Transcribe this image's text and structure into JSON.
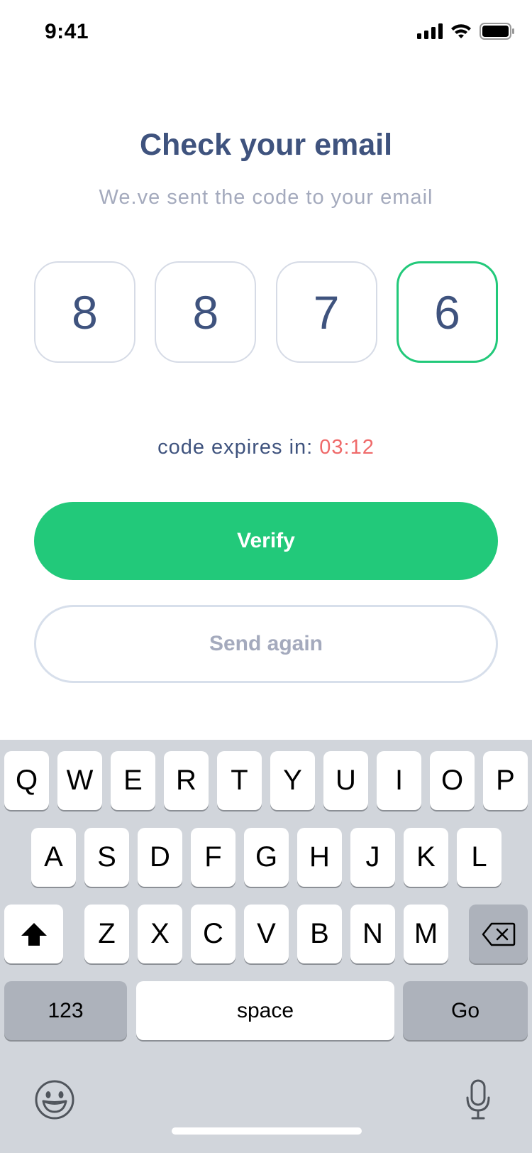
{
  "status_bar": {
    "time": "9:41",
    "icons": [
      "signal-icon",
      "wifi-icon",
      "battery-icon"
    ]
  },
  "header": {
    "title": "Check your email",
    "subtitle": "We.ve sent the code to your email"
  },
  "code": {
    "digits": [
      "8",
      "8",
      "7",
      "6"
    ],
    "active_index": 3
  },
  "timer": {
    "label": "code expires in:",
    "value": "03:12"
  },
  "buttons": {
    "verify": "Verify",
    "send_again": "Send again"
  },
  "keyboard": {
    "row1": [
      "Q",
      "W",
      "E",
      "R",
      "T",
      "Y",
      "U",
      "I",
      "O",
      "P"
    ],
    "row2": [
      "A",
      "S",
      "D",
      "F",
      "G",
      "H",
      "J",
      "K",
      "L"
    ],
    "row3": [
      "Z",
      "X",
      "C",
      "V",
      "B",
      "N",
      "M"
    ],
    "numbers_key": "123",
    "space_key": "space",
    "go_key": "Go",
    "icons": [
      "shift-icon",
      "backspace-icon",
      "emoji-icon",
      "microphone-icon"
    ]
  },
  "colors": {
    "accent": "#22c97a",
    "title": "#3f537e",
    "muted": "#a4aabd",
    "timer": "#ef6a6a",
    "keyboard_bg": "#d1d5db"
  }
}
